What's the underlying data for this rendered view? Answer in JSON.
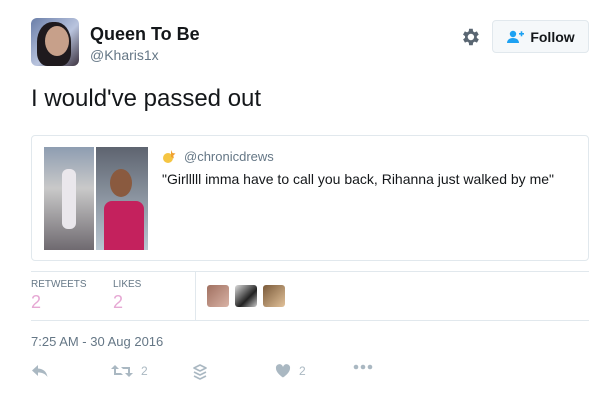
{
  "author": {
    "display_name": "Queen To Be",
    "handle": "@Kharis1x"
  },
  "header": {
    "follow_label": "Follow"
  },
  "tweet": {
    "text": "I would've passed out"
  },
  "quoted_tweet": {
    "handle": "@chronicdrews",
    "text": "\"Girlllll imma have to call you back, Rihanna just walked by me\""
  },
  "stats": {
    "retweets_label": "RETWEETS",
    "retweets_count": "2",
    "likes_label": "LIKES",
    "likes_count": "2"
  },
  "timestamp": "7:25 AM - 30 Aug 2016",
  "actions": {
    "retweet_count": "2",
    "like_count": "2"
  },
  "colors": {
    "accent_pink": "#e6a8d4",
    "muted": "#657786",
    "icon_gray": "#aab8c2"
  }
}
